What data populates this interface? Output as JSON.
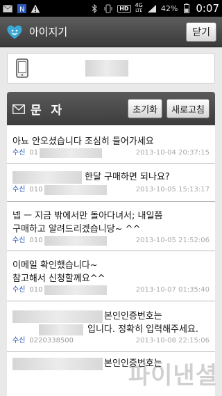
{
  "status_bar": {
    "battery_percent": "42%",
    "time": "0:07",
    "network": "4G",
    "network_sub": "LTE",
    "hd_label": "HD",
    "left_icons": [
      "mail-icon",
      "n-app-icon",
      "warning-icon"
    ],
    "right_icons": [
      "bluetooth-icon",
      "vibrate-icon",
      "hd-voice-icon",
      "signal-icon",
      "battery-icon"
    ]
  },
  "titlebar": {
    "title": "아이지기",
    "close_label": "닫기",
    "logo_icon": "heart-logo-icon"
  },
  "phone_box": {
    "icon": "mobile-phone-icon",
    "number_redacted": true
  },
  "panel": {
    "title": "문 자",
    "reset_label": "초기화",
    "refresh_label": "새로고침",
    "icon": "envelope-icon"
  },
  "messages": [
    {
      "line1": "아뇨 안오셨습니다 조심히 들어가세요",
      "line2": "",
      "type": "수신",
      "sender": "01",
      "date": "2013-10-04 20:37:15"
    },
    {
      "line1": "한달 구매하면 되나요?",
      "line2": "",
      "type": "수신",
      "sender": "010",
      "date": "2013-10-05 15:13:17"
    },
    {
      "line1": "넵 ㅡ 지금 밖에서만 돌아다녀서; 내일쯤",
      "line2": "구매하고 알려드리겠습니당~ ^^",
      "type": "수신",
      "sender": "010",
      "date": "2013-10-05 21:52:06"
    },
    {
      "line1": "이메일 확인했습니다~",
      "line2": "참고해서 신청할께요^^",
      "type": "수신",
      "sender": "010",
      "date": "2013-10-07 01:35:40"
    },
    {
      "line1": "본인인증번호는",
      "line2": "입니다. 정확히 입력해주세요.",
      "type": "수신",
      "sender": "0220338500",
      "date": "2013-10-08 22:15:06"
    },
    {
      "line1": "본인인증번호는",
      "line2": "",
      "type": "",
      "sender": "",
      "date": ""
    }
  ],
  "watermark": "파이낸셜"
}
